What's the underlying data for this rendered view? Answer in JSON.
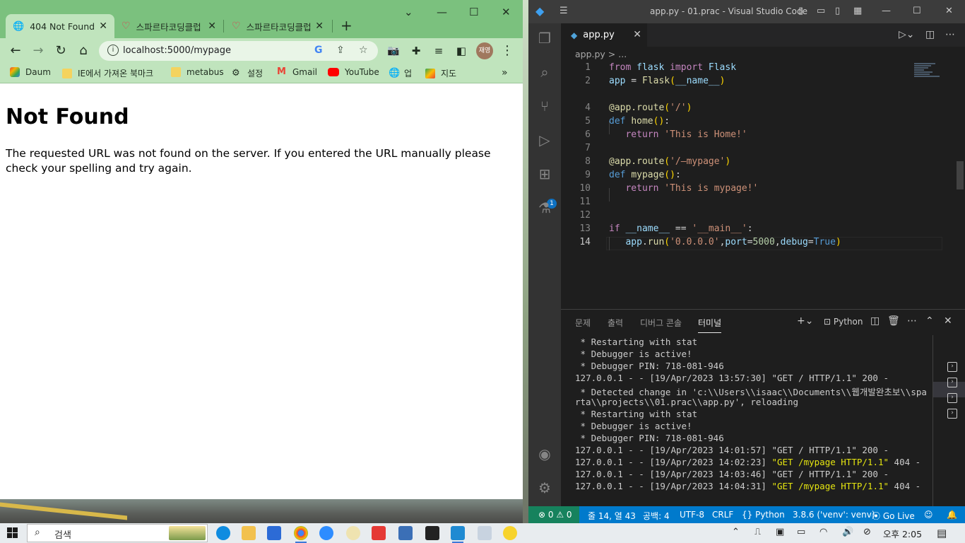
{
  "chrome": {
    "tabs": [
      {
        "title": "404 Not Found",
        "active": true
      },
      {
        "title": "스파르타코딩클럽",
        "active": false
      },
      {
        "title": "스파르타코딩클럽",
        "active": false
      }
    ],
    "url": "localhost:5000/mypage",
    "avatar_text": "재영",
    "bookmarks": [
      {
        "label": "Daum",
        "icon": "daum-icon"
      },
      {
        "label": "IE에서 가져온 북마크",
        "icon": "folder-icon"
      },
      {
        "label": "metabus",
        "icon": "folder-icon"
      },
      {
        "label": "설정",
        "icon": "gear-icon"
      },
      {
        "label": "Gmail",
        "icon": "gmail-icon"
      },
      {
        "label": "YouTube",
        "icon": "youtube-icon"
      },
      {
        "label": "업",
        "icon": "globe-icon"
      },
      {
        "label": "지도",
        "icon": "maps-icon"
      }
    ],
    "page": {
      "heading": "Not Found",
      "message": "The requested URL was not found on the server. If you entered the URL manually please check your spelling and try again."
    }
  },
  "vscode": {
    "title": "app.py - 01.prac - Visual Studio Code",
    "tab": "app.py",
    "breadcrumb": "app.py > ...",
    "extensions_badge": "1",
    "code": [
      {
        "n": "1",
        "text": "from flask import Flask"
      },
      {
        "n": "2",
        "text": "app = Flask(__name__)"
      },
      {
        "n": "4",
        "text": "@app.route('/')"
      },
      {
        "n": "5",
        "text": "def home():"
      },
      {
        "n": "6",
        "text": "   return 'This is Home!'"
      },
      {
        "n": "7",
        "text": ""
      },
      {
        "n": "8",
        "text": "@app.route('/—mypage')"
      },
      {
        "n": "9",
        "text": "def mypage():"
      },
      {
        "n": "10",
        "text": "   return 'This is mypage!'"
      },
      {
        "n": "11",
        "text": ""
      },
      {
        "n": "12",
        "text": ""
      },
      {
        "n": "13",
        "text": "if __name__ == '__main__':"
      },
      {
        "n": "14",
        "text": "   app.run('0.0.0.0',port=5000,debug=True)"
      }
    ],
    "panel_tabs": [
      "문제",
      "출력",
      "디버그 콘솔",
      "터미널"
    ],
    "shell_label": "Python",
    "terminal": [
      " * Restarting with stat",
      " * Debugger is active!",
      " * Debugger PIN: 718-081-946",
      "127.0.0.1 - - [19/Apr/2023 13:57:30] \"GET / HTTP/1.1\" 200 -",
      " * Detected change in 'c:\\\\Users\\\\isaac\\\\Documents\\\\웹개발완초보\\\\spa",
      "rta\\\\projects\\\\01.prac\\\\app.py', reloading",
      " * Restarting with stat",
      " * Debugger is active!",
      " * Debugger PIN: 718-081-946",
      "127.0.0.1 - - [19/Apr/2023 14:01:57] \"GET / HTTP/1.1\" 200 -",
      "127.0.0.1 - - [19/Apr/2023 14:02:23] ",
      "127.0.0.1 - - [19/Apr/2023 14:03:46] \"GET / HTTP/1.1\" 200 -",
      "127.0.0.1 - - [19/Apr/2023 14:04:31] "
    ],
    "terminal_highlight": "\"GET /mypage HTTP/1.1\"",
    "terminal_tail": " 404 -",
    "status": {
      "errors": "0",
      "warnings": "0",
      "position": "줄 14, 열 43",
      "spaces": "공백: 4",
      "encoding": "UTF-8",
      "eol": "CRLF",
      "language": "Python",
      "interpreter": "3.8.6 ('venv': venv)",
      "golive": "Go Live"
    }
  },
  "taskbar": {
    "search_placeholder": "검색",
    "time": "오후 2:05"
  }
}
